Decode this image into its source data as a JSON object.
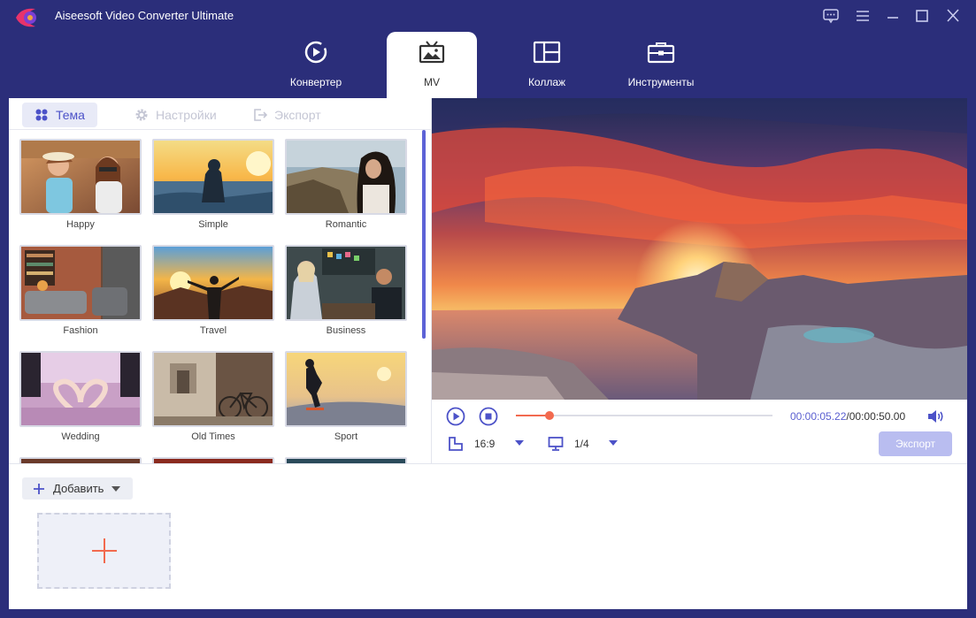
{
  "app": {
    "title": "Aiseesoft Video Converter Ultimate",
    "accent": "#5d63d6",
    "header_bg": "#2b2e7a",
    "highlight": "#f26a4f"
  },
  "nav": {
    "tabs": [
      {
        "label": "Конвертер",
        "icon": "convert-icon",
        "active": false
      },
      {
        "label": "MV",
        "icon": "mv-icon",
        "active": true
      },
      {
        "label": "Коллаж",
        "icon": "collage-icon",
        "active": false
      },
      {
        "label": "Инструменты",
        "icon": "toolbox-icon",
        "active": false
      }
    ]
  },
  "subtabs": [
    {
      "label": "Тема",
      "icon": "theme-icon",
      "active": true
    },
    {
      "label": "Настройки",
      "icon": "gear-icon",
      "active": false
    },
    {
      "label": "Экспорт",
      "icon": "export-icon",
      "active": false
    }
  ],
  "themes": [
    {
      "name": "Happy"
    },
    {
      "name": "Simple"
    },
    {
      "name": "Romantic"
    },
    {
      "name": "Fashion"
    },
    {
      "name": "Travel"
    },
    {
      "name": "Business"
    },
    {
      "name": "Wedding"
    },
    {
      "name": "Old Times"
    },
    {
      "name": "Sport"
    }
  ],
  "player": {
    "current_time": "00:00:05.22",
    "separator": "/",
    "total_time": "00:00:50.00",
    "progress_fraction": 0.13,
    "aspect_ratio": "16:9",
    "view_fraction": "1/4",
    "export_label": "Экспорт"
  },
  "bottom": {
    "add_label": "Добавить"
  }
}
